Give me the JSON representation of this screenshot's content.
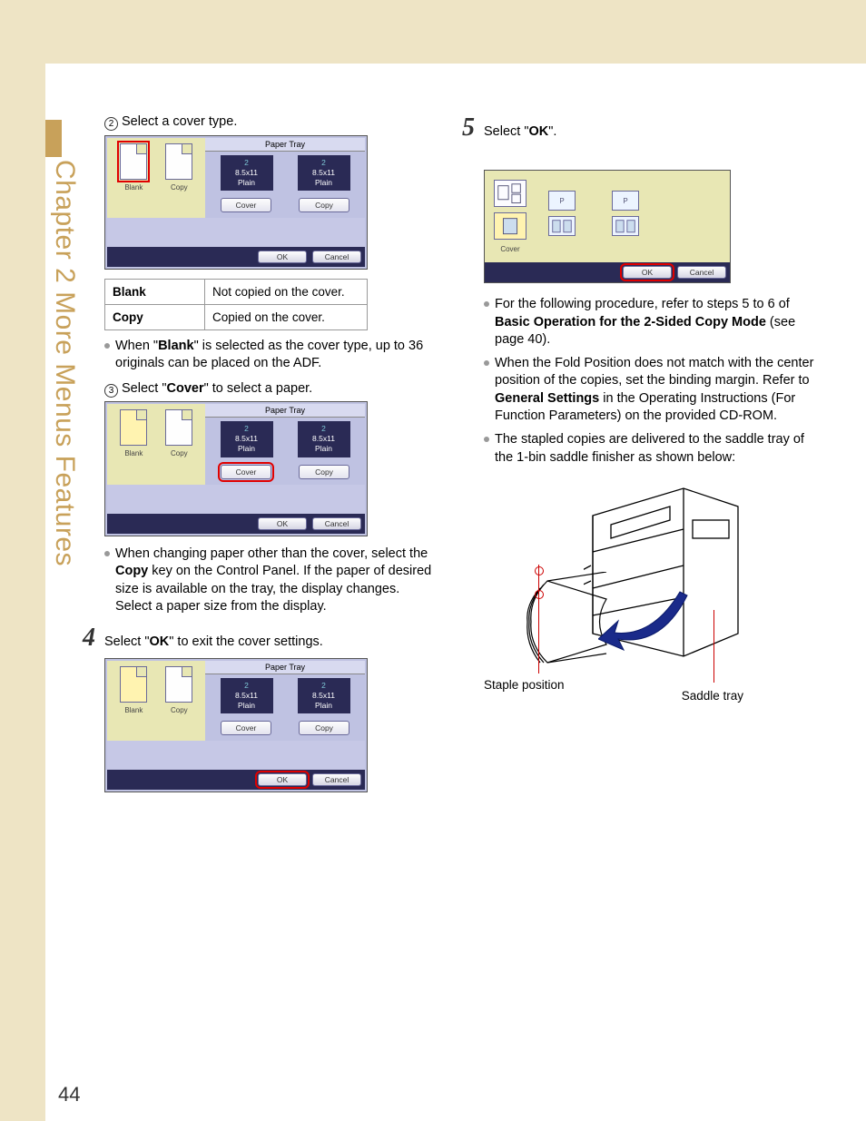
{
  "side_title": "Chapter 2    More Menus Features",
  "page_number": "44",
  "left": {
    "sub2": {
      "marker": "2",
      "text": "Select a cover type."
    },
    "lcd_a": {
      "tray_title": "Paper Tray",
      "blank": "Blank",
      "copy": "Copy",
      "tray1_num": "2",
      "tray1_size": "8.5x11",
      "tray1_type": "Plain",
      "tray2_num": "2",
      "tray2_size": "8.5x11",
      "tray2_type": "Plain",
      "mode_cover": "Cover",
      "mode_copy": "Copy",
      "ok": "OK",
      "cancel": "Cancel",
      "highlight": "blank-option"
    },
    "table": {
      "r1c1": "Blank",
      "r1c2": "Not copied on the cover.",
      "r2c1": "Copy",
      "r2c2": "Copied on the cover."
    },
    "bullet_a": {
      "pre": "When \"",
      "bold": "Blank",
      "post": "\" is selected as the cover type, up to 36 originals can be placed on the ADF."
    },
    "sub3": {
      "marker": "3",
      "pre": "Select \"",
      "bold": "Cover",
      "post": "\" to select a paper."
    },
    "lcd_b": {
      "tray_title": "Paper Tray",
      "blank": "Blank",
      "copy": "Copy",
      "tray1_num": "2",
      "tray1_size": "8.5x11",
      "tray1_type": "Plain",
      "tray2_num": "2",
      "tray2_size": "8.5x11",
      "tray2_type": "Plain",
      "mode_cover": "Cover",
      "mode_copy": "Copy",
      "ok": "OK",
      "cancel": "Cancel",
      "highlight": "cover-mode"
    },
    "bullet_b": {
      "pre": "When changing paper other than the cover, select the ",
      "bold": "Copy",
      "post": " key on the Control Panel. If the paper of desired size is available on the tray, the display changes.",
      "line2": "Select a paper size from the display."
    },
    "step4": {
      "num": "4",
      "pre": "Select \"",
      "bold": "OK",
      "post": "\" to exit the cover settings."
    },
    "lcd_c": {
      "tray_title": "Paper Tray",
      "blank": "Blank",
      "copy": "Copy",
      "tray1_num": "2",
      "tray1_size": "8.5x11",
      "tray1_type": "Plain",
      "tray2_num": "2",
      "tray2_size": "8.5x11",
      "tray2_type": "Plain",
      "mode_cover": "Cover",
      "mode_copy": "Copy",
      "ok": "OK",
      "cancel": "Cancel",
      "highlight": "ok-button"
    }
  },
  "right": {
    "step5": {
      "num": "5",
      "pre": "Select \"",
      "bold": "OK",
      "post": "\"."
    },
    "lcd2": {
      "cover": "Cover",
      "p": "P",
      "ok": "OK",
      "cancel": "Cancel",
      "highlight": "ok-button"
    },
    "bullet1": {
      "pre": "For the following procedure, refer to steps 5 to 6 of ",
      "bold": "Basic Operation for the 2-Sided Copy Mode",
      "post": " (see page 40)."
    },
    "bullet2": {
      "pre": "When the Fold Position does not match with the center position of the copies, set the binding margin. Refer to ",
      "bold": "General Settings",
      "post": " in the Operating Instructions (For Function Parameters) on the provided CD-ROM."
    },
    "bullet3": {
      "text": "The stapled copies are delivered to the saddle tray of the 1-bin saddle finisher as shown below:"
    },
    "illus": {
      "staple": "Staple position",
      "saddle": "Saddle tray"
    }
  }
}
